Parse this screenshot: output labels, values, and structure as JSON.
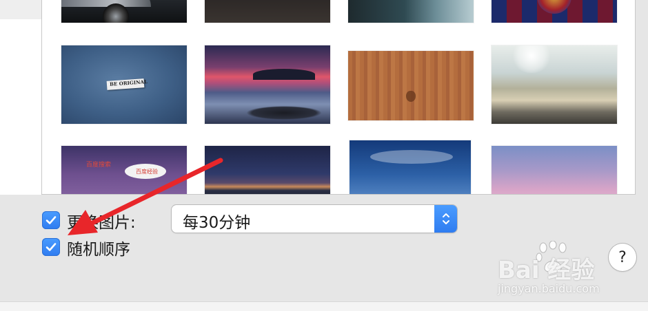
{
  "preferences": {
    "change_picture_label": "更换图片:",
    "change_picture_checked": true,
    "interval_value": "每30分钟",
    "random_order_label": "随机顺序",
    "random_order_checked": true,
    "help_label": "?"
  },
  "thumbnails": {
    "be_original_text": "BE ORIGINAL",
    "purple_text_1": "百度搜索",
    "purple_text_2": "百度经验"
  },
  "watermark": {
    "logo_text": "Bai  经验",
    "url": "jingyan.baidu.com"
  },
  "colors": {
    "accent_blue": "#2f7cf0",
    "annotation_arrow": "#e8262a"
  },
  "icons": {
    "checkbox": "checkmark-icon",
    "stepper": "chevron-updown-icon",
    "annotation": "red-arrow"
  }
}
